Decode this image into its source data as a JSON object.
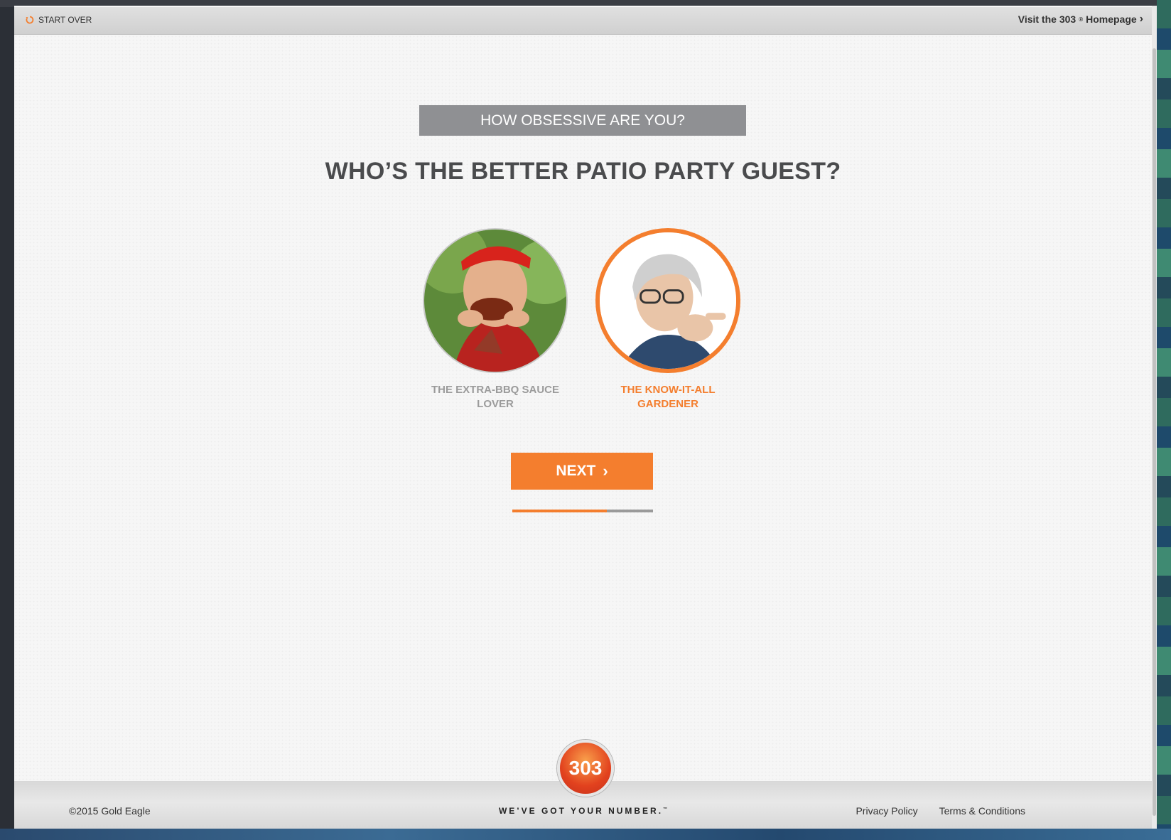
{
  "topbar": {
    "start_over": "START OVER",
    "visit_prefix": "Visit the 303",
    "visit_reg": "®",
    "visit_suffix": " Homepage"
  },
  "quiz": {
    "eyebrow": "HOW OBSESSIVE ARE YOU?",
    "question": "WHO’S THE BETTER PATIO PARTY GUEST?",
    "choices": [
      {
        "label": "THE EXTRA-BBQ SAUCE LOVER",
        "selected": false
      },
      {
        "label": "THE KNOW-IT-ALL GARDENER",
        "selected": true
      }
    ],
    "next_label": "NEXT",
    "progress": 0.67
  },
  "footer": {
    "copyright": "©2015 Gold Eagle",
    "tagline": "WE’VE GOT YOUR NUMBER.",
    "tagline_tm": "™",
    "logo_text": "303",
    "privacy": "Privacy Policy",
    "terms": "Terms & Conditions"
  },
  "colors": {
    "accent": "#f47e2e",
    "eyebrow_bg": "#8f9093",
    "heading": "#4a4b4d"
  },
  "icons": {
    "restart": "restart-icon",
    "chevron": "chevron-right-icon"
  }
}
